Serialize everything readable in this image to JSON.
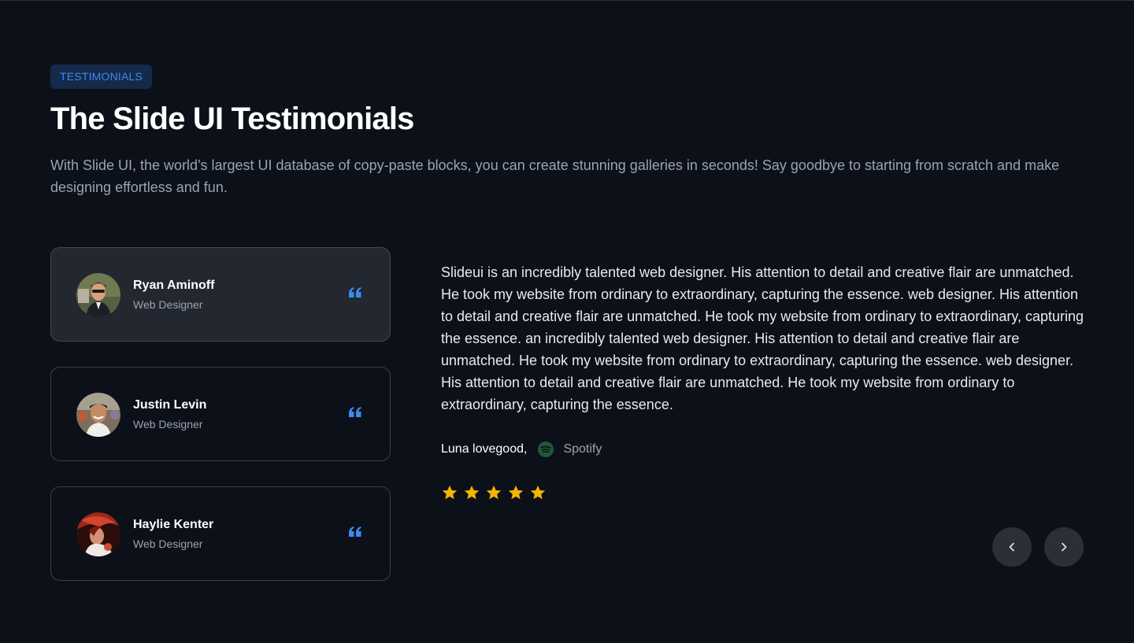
{
  "badge": "TESTIMONIALS",
  "title": "The Slide UI Testimonials",
  "subtitle": "With Slide UI, the world's largest UI database of copy-paste blocks, you can create stunning galleries in seconds! Say goodbye to starting from scratch and make designing effortless and fun.",
  "people": [
    {
      "name": "Ryan Aminoff",
      "role": "Web Designer",
      "active": true
    },
    {
      "name": "Justin Levin",
      "role": "Web Designer",
      "active": false
    },
    {
      "name": "Haylie Kenter",
      "role": "Web Designer",
      "active": false
    }
  ],
  "testimonial": {
    "text": "Slideui is an incredibly talented web designer. His attention to detail and creative flair are unmatched. He took my website from ordinary to extraordinary, capturing the essence. web designer. His attention to detail and creative flair are unmatched. He took my website from ordinary to extraordinary, capturing the essence. an incredibly talented web designer. His attention to detail and creative flair are unmatched. He took my website from ordinary to extraordinary, capturing the essence. web designer. His attention to detail and creative flair are unmatched. He took my website from ordinary to extraordinary, capturing the essence.",
    "author": "Luna lovegood,",
    "company": "Spotify",
    "rating": 5
  },
  "icons": {
    "quote": "quote-icon",
    "company": "spotify-icon",
    "star": "star-icon",
    "prev": "chevron-left-icon",
    "next": "chevron-right-icon"
  },
  "colors": {
    "background": "#0c1019",
    "accent": "#3b8bf0",
    "star": "#f5b400",
    "active_card": "#222730"
  }
}
